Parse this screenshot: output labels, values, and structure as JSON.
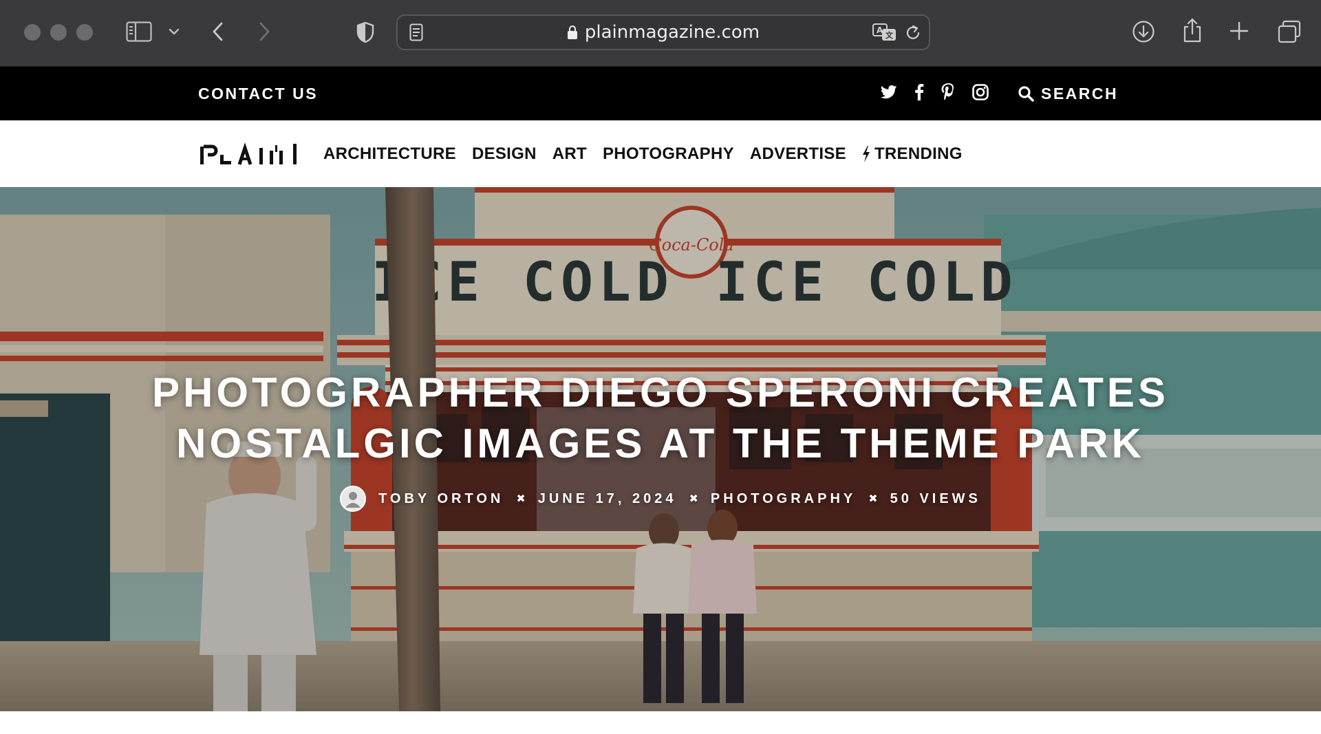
{
  "browser": {
    "url": "plainmagazine.com",
    "icons": [
      "sidebar-icon",
      "chevron-down-icon",
      "back-icon",
      "forward-icon",
      "shield-icon",
      "reader-icon",
      "lock-icon",
      "translate-icon",
      "reload-icon",
      "download-icon",
      "share-icon",
      "new-tab-icon",
      "tabs-overview-icon"
    ]
  },
  "topbar": {
    "contact_label": "CONTACT US",
    "social_icons": [
      "twitter-icon",
      "facebook-icon",
      "pinterest-icon",
      "instagram-icon"
    ],
    "search_label": "SEARCH"
  },
  "nav": {
    "logo_text": "PLAIN",
    "links": [
      "ARCHITECTURE",
      "DESIGN",
      "ART",
      "PHOTOGRAPHY",
      "ADVERTISE",
      "TRENDING"
    ]
  },
  "hero": {
    "title_line1": "PHOTOGRAPHER DIEGO SPERONI CREATES",
    "title_line2": "NOSTALGIC IMAGES AT THE THEME PARK",
    "author": "TOBY ORTON",
    "date": "JUNE 17, 2024",
    "category": "PHOTOGRAPHY",
    "views": "50 VIEWS",
    "separator": "✖",
    "sign_text": "ICE COLD",
    "logo_text": "Coca-Cola"
  },
  "colors": {
    "chrome_bg": "#3a3a3c",
    "topbar_bg": "#000000",
    "nav_bg": "#ffffff",
    "stand_red": "#c8462e"
  }
}
